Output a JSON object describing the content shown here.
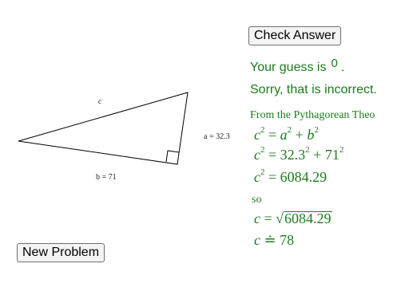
{
  "buttons": {
    "check_answer": "Check Answer",
    "new_problem": "New Problem"
  },
  "feedback": {
    "guess_prefix": "Your guess is",
    "guess_value": "0",
    "guess_suffix": ".",
    "verdict": "Sorry, that is incorrect.",
    "explanation_intro": "From the Pythagorean Theo",
    "connector": "so"
  },
  "triangle": {
    "label_c": "c",
    "label_a": "a = 32.3",
    "label_b": "b = 71"
  },
  "equations": {
    "eq1": {
      "lhs_var": "c",
      "lhs_exp": "2",
      "eq": " = ",
      "t1_var": "a",
      "t1_exp": "2",
      "plus": " + ",
      "t2_var": "b",
      "t2_exp": "2"
    },
    "eq2": {
      "lhs_var": "c",
      "lhs_exp": "2",
      "eq": " = ",
      "t1": "32.3",
      "t1_exp": "2",
      "plus": " + ",
      "t2": "71",
      "t2_exp": "2"
    },
    "eq3": {
      "lhs_var": "c",
      "lhs_exp": "2",
      "eq": " = ",
      "value": "6084.29"
    },
    "eq4": {
      "lhs_var": "c",
      "eq": " = ",
      "sqrt_sign": "√",
      "radicand": "6084.29"
    },
    "eq5": {
      "lhs_var": "c",
      "approx": " ≐ ",
      "value": "78"
    }
  },
  "colors": {
    "feedback_text": "#1e7a1e",
    "triangle_stroke": "#000000"
  }
}
